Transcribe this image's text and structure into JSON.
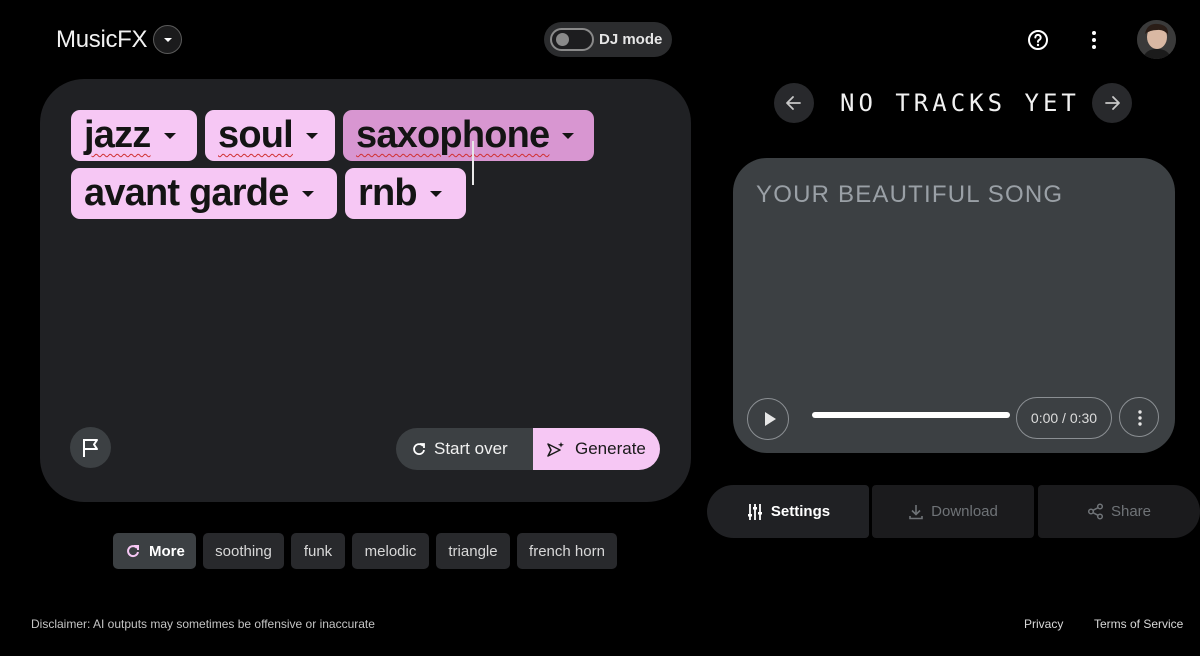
{
  "app": {
    "title": "MusicFX"
  },
  "header": {
    "dj_mode_label": "DJ mode"
  },
  "prompt": {
    "chips": [
      {
        "label": "jazz",
        "selected": false
      },
      {
        "label": "soul",
        "selected": false
      },
      {
        "label": "saxophone",
        "selected": true
      },
      {
        "label": "avant garde",
        "selected": false
      },
      {
        "label": "rnb",
        "selected": false
      }
    ],
    "start_over_label": "Start over",
    "generate_label": "Generate"
  },
  "suggestions": {
    "more_label": "More",
    "items": [
      "soothing",
      "funk",
      "melodic",
      "triangle",
      "french horn"
    ]
  },
  "tracks": {
    "title": "NO TRACKS YET"
  },
  "song": {
    "title": "YOUR BEAUTIFUL SONG",
    "time": "0:00 / 0:30"
  },
  "actions": {
    "settings_label": "Settings",
    "download_label": "Download",
    "share_label": "Share"
  },
  "footer": {
    "disclaimer": "Disclaimer: AI outputs may sometimes be offensive or inaccurate",
    "privacy": "Privacy",
    "terms": "Terms of Service"
  },
  "colors": {
    "chip": "#f6c7f4",
    "chip_selected": "#d896d1",
    "panel": "#202124",
    "card": "#3c4043"
  }
}
